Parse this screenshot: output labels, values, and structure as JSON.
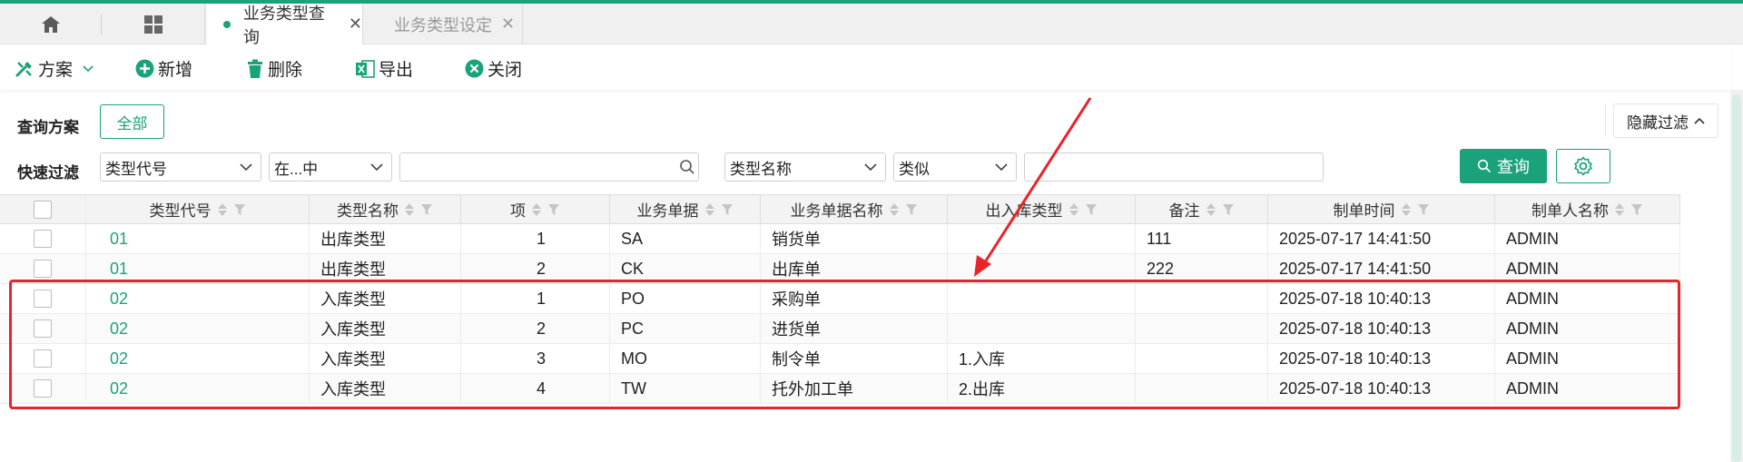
{
  "tabs": [
    {
      "label": "业务类型查询",
      "active": true
    },
    {
      "label": "业务类型设定",
      "active": false
    }
  ],
  "toolbar": {
    "scheme": "方案",
    "add": "新增",
    "delete": "删除",
    "export": "导出",
    "close": "关闭"
  },
  "filter": {
    "query_scheme_label": "查询方案",
    "all_button": "全部",
    "hide_filter": "隐藏过滤",
    "quick_filter_label": "快速过滤",
    "field1": "类型代号",
    "op1": "在...中",
    "value1": "",
    "field2": "类型名称",
    "op2": "类似",
    "value2": "",
    "query_button": "查询"
  },
  "table": {
    "columns": [
      "类型代号",
      "类型名称",
      "项",
      "业务单据",
      "业务单据名称",
      "出入库类型",
      "备注",
      "制单时间",
      "制单人名称"
    ],
    "rows": [
      [
        "01",
        "出库类型",
        "1",
        "SA",
        "销货单",
        "",
        "111",
        "2025-07-17 14:41:50",
        "ADMIN"
      ],
      [
        "01",
        "出库类型",
        "2",
        "CK",
        "出库单",
        "",
        "222",
        "2025-07-17 14:41:50",
        "ADMIN"
      ],
      [
        "02",
        "入库类型",
        "1",
        "PO",
        "采购单",
        "",
        "",
        "2025-07-18 10:40:13",
        "ADMIN"
      ],
      [
        "02",
        "入库类型",
        "2",
        "PC",
        "进货单",
        "",
        "",
        "2025-07-18 10:40:13",
        "ADMIN"
      ],
      [
        "02",
        "入库类型",
        "3",
        "MO",
        "制令单",
        "1.入库",
        "",
        "2025-07-18 10:40:13",
        "ADMIN"
      ],
      [
        "02",
        "入库类型",
        "4",
        "TW",
        "托外加工单",
        "2.出库",
        "",
        "2025-07-18 10:40:13",
        "ADMIN"
      ]
    ]
  },
  "colors": {
    "accent": "#1aa37a",
    "highlight": "#e8232b"
  }
}
